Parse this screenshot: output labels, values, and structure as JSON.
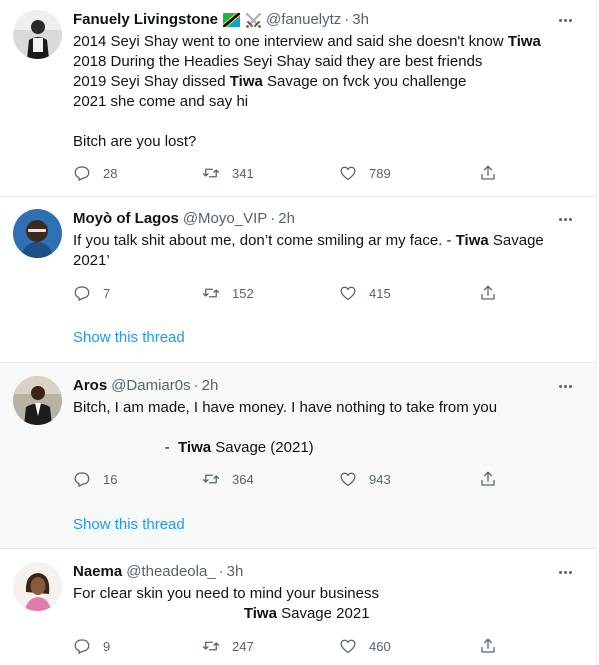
{
  "tweets": [
    {
      "name": "Fanuely Livingstone",
      "emoji": [
        "tanzania-flag",
        "crossed-swords"
      ],
      "handle": "@fanuelytz",
      "dot": "·",
      "time": "3h",
      "lines": [
        {
          "pre": "2014 Seyi Shay went to one interview and said she doesn't know ",
          "bold": "Tiwa",
          "post": ""
        },
        {
          "pre": "2018 During the Headies Seyi Shay said they are best friends",
          "bold": "",
          "post": ""
        },
        {
          "pre": "2019 Seyi Shay dissed ",
          "bold": "Tiwa",
          "post": " Savage on fvck you challenge"
        },
        {
          "pre": "2021 she come and say hi",
          "bold": "",
          "post": ""
        },
        {
          "pre": "",
          "bold": "",
          "post": ""
        },
        {
          "pre": "Bitch are you lost?",
          "bold": "",
          "post": ""
        }
      ],
      "replies": "28",
      "retweets": "341",
      "likes": "789"
    },
    {
      "name": "Moyò of Lagos",
      "handle": "@Moyo_VIP",
      "dot": "·",
      "time": "2h",
      "lines": [
        {
          "pre": "If you talk shit about me, don’t come smiling ar my face. - ",
          "bold": "Tiwa",
          "post": " Savage"
        },
        {
          "pre": "2021’",
          "bold": "",
          "post": ""
        }
      ],
      "replies": "7",
      "retweets": "152",
      "likes": "415",
      "show_thread": "Show this thread"
    },
    {
      "name": "Aros",
      "handle": "@Damiar0s",
      "dot": "·",
      "time": "2h",
      "lines": [
        {
          "pre": "Bitch, I am made, I have money. I have nothing to take from you",
          "bold": "",
          "post": ""
        },
        {
          "pre": "",
          "bold": "",
          "post": ""
        },
        {
          "pre": "                      -  ",
          "bold": "Tiwa",
          "post": " Savage (2021)"
        }
      ],
      "replies": "16",
      "retweets": "364",
      "likes": "943",
      "show_thread": "Show this thread"
    },
    {
      "name": "Naema",
      "handle": "@theadeola_",
      "dot": "·",
      "time": "3h",
      "lines": [
        {
          "pre": "For clear skin you need to mind your business",
          "bold": "",
          "post": ""
        },
        {
          "pre": "                                         ",
          "bold": "Tiwa",
          "post": " Savage 2021"
        }
      ],
      "replies": "9",
      "retweets": "247",
      "likes": "460"
    }
  ],
  "icons": {
    "reply": "reply-icon",
    "retweet": "retweet-icon",
    "like": "like-icon",
    "share": "share-icon",
    "more": "more-icon"
  },
  "colors": {
    "text": "#0f1419",
    "secondary": "#536471",
    "link": "#1d9bf0",
    "divider": "#e6ecf0",
    "hover_bg": "#f7f9f9"
  }
}
